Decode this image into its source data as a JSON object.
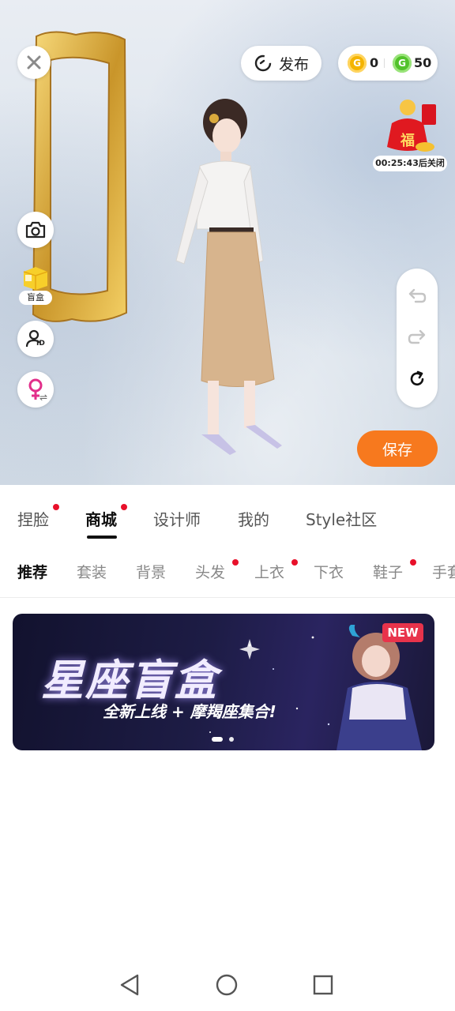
{
  "top": {
    "publish_label": "发布",
    "coin_gold": "0",
    "coin_green": "50",
    "gold_coin_glyph": "G",
    "green_coin_glyph": "G"
  },
  "promo": {
    "lucky_char": "福",
    "timer": "00:25:43后关闭"
  },
  "side": {
    "blind_box_label": "盲盒",
    "id_glyph": "ID"
  },
  "save_label": "保存",
  "main_tabs": [
    "捏脸",
    "商城",
    "设计师",
    "我的",
    "Style社区"
  ],
  "sub_tabs": [
    "推荐",
    "套装",
    "背景",
    "头发",
    "上衣",
    "下衣",
    "鞋子",
    "手套"
  ],
  "banner": {
    "title": "星座盲盒",
    "subtitle": "全新上线 + 摩羯座集合!",
    "badge": "NEW"
  },
  "colors": {
    "accent": "#ff6a13",
    "badge_red": "#e8102a",
    "save_bg": "#f7791e"
  },
  "icons": [
    "close-icon",
    "publish-icon",
    "camera-icon",
    "blind-box-icon",
    "id-icon",
    "gender-female-icon",
    "undo-icon",
    "redo-icon",
    "reset-icon",
    "nav-back-icon",
    "nav-home-icon",
    "nav-recents-icon"
  ]
}
